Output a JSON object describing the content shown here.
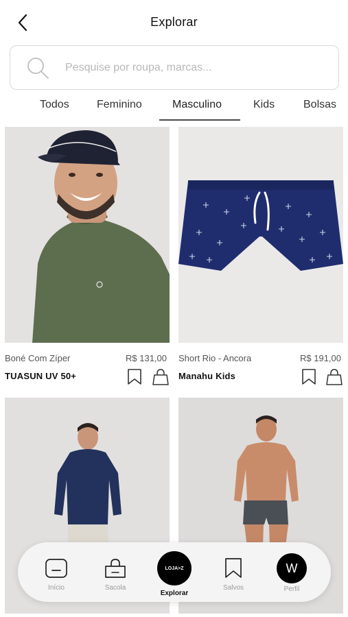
{
  "header": {
    "title": "Explorar"
  },
  "search": {
    "placeholder": "Pesquise por roupa, marcas..."
  },
  "tabs": [
    {
      "label": "Todos",
      "active": false
    },
    {
      "label": "Feminino",
      "active": false
    },
    {
      "label": "Masculino",
      "active": true
    },
    {
      "label": "Kids",
      "active": false
    },
    {
      "label": "Bolsas",
      "active": false
    }
  ],
  "products": [
    {
      "name": "Boné Com Zíper",
      "price": "R$ 131,00",
      "brand": "TUASUN UV 50+"
    },
    {
      "name": "Short Rio - Ancora",
      "price": "R$ 191,00",
      "brand": "Manahu Kids"
    }
  ],
  "nav": {
    "items": [
      {
        "label": "Início",
        "icon": "home-icon"
      },
      {
        "label": "Sacola",
        "icon": "bag-icon"
      },
      {
        "label": "Explorar",
        "icon": "explore-logo-icon",
        "badge": "LOJA>Z",
        "active": true
      },
      {
        "label": "Salvos",
        "icon": "bookmark-icon"
      },
      {
        "label": "Perfil",
        "icon": "profile-avatar",
        "initial": "W"
      }
    ]
  },
  "colors": {
    "accent": "#000000",
    "navbar_bg": "#f4f4f4",
    "short_navy": "#1f2d6e",
    "shirt_green": "#5d6e4e"
  }
}
